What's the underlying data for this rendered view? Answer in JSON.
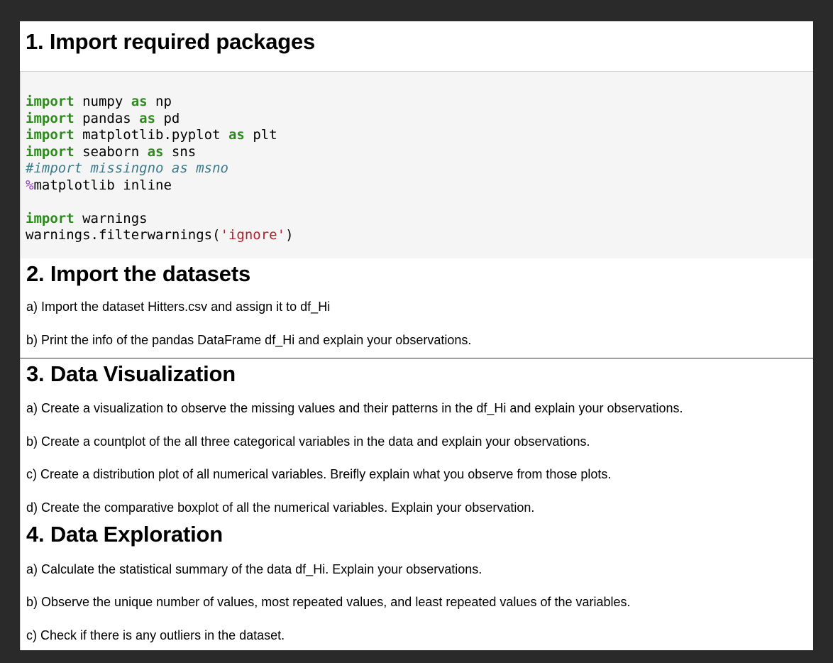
{
  "section1": {
    "title": "1. Import required packages"
  },
  "code": {
    "line1": {
      "kw1": "import",
      "mod": " numpy ",
      "kw2": "as",
      "alias": " np"
    },
    "line2": {
      "kw1": "import",
      "mod": " pandas ",
      "kw2": "as",
      "alias": " pd"
    },
    "line3": {
      "kw1": "import",
      "mod": " matplotlib.pyplot ",
      "kw2": "as",
      "alias": " plt"
    },
    "line4": {
      "kw1": "import",
      "mod": " seaborn ",
      "kw2": "as",
      "alias": " sns"
    },
    "line5": "#import missingno as msno",
    "line6": {
      "magic": "%",
      "rest": "matplotlib inline"
    },
    "line8": {
      "kw1": "import",
      "mod": " warnings"
    },
    "line9": {
      "pre": "warnings.filterwarnings(",
      "str": "'ignore'",
      "post": ")"
    }
  },
  "section2": {
    "title": "2. Import the datasets",
    "items": [
      "a) Import the dataset Hitters.csv and assign it to df_Hi",
      "b) Print the info of the pandas DataFrame df_Hi and explain your observations."
    ]
  },
  "section3": {
    "title": "3. Data Visualization",
    "items": [
      "a) Create a visualization to observe the missing values and their patterns in the df_Hi and explain your observations.",
      "b) Create a countplot of the all three categorical variables in the data and explain your observations.",
      "c) Create a distribution plot of all numerical variables. Breifly explain what you observe from those plots.",
      "d) Create the comparative boxplot of all the numerical variables. Explain your observation."
    ]
  },
  "section4": {
    "title": "4. Data Exploration",
    "items": [
      "a) Calculate the statistical summary of the data df_Hi. Explain your observations.",
      "b) Observe the unique number of values, most repeated values, and least repeated values of the variables.",
      "c) Check if there is any outliers in the dataset."
    ]
  }
}
